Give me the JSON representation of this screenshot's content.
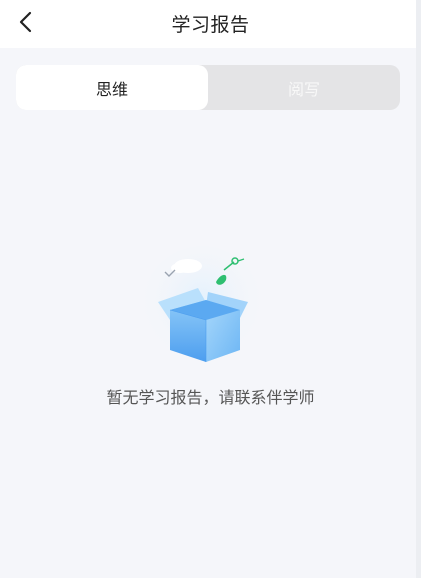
{
  "header": {
    "title": "学习报告",
    "back_icon": "chevron-left-icon"
  },
  "tabs": [
    {
      "label": "思维",
      "active": true
    },
    {
      "label": "阅写",
      "active": false
    }
  ],
  "empty_state": {
    "illustration": "empty-box-icon",
    "message": "暂无学习报告，请联系伴学师"
  },
  "colors": {
    "background": "#f5f6fa",
    "tab_active_bg": "#ffffff",
    "tab_inactive_bg": "#e4e4e6",
    "box_blue": "#6fb8f5",
    "leaf_green": "#2fbf71"
  }
}
